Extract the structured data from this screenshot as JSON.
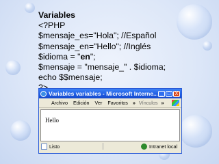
{
  "code": {
    "title": "Variables",
    "lines": [
      "<?PHP",
      "$mensaje_es=\"Hola\"; //Español",
      "$mensaje_en=\"Hello\"; //Inglés",
      "echo $$mensaje;",
      "?>"
    ],
    "line_idioma_prefix": "$idioma = \"",
    "line_idioma_value": "en",
    "line_idioma_suffix": "\";",
    "line_concat": "$mensaje = \"mensaje_\" . $idioma;"
  },
  "browser": {
    "window_title": "Variables variables - Microsoft Interne...",
    "minimize": "_",
    "maximize": "□",
    "close": "X",
    "menu": {
      "archivo": "Archivo",
      "edicion": "Edición",
      "ver": "Ver",
      "favoritos": "Favoritos",
      "chevron": "»",
      "vinculos": "Vínculos",
      "chevron2": "»"
    },
    "content_text": "Hello",
    "status_left": "Listo",
    "status_zone": "Intranet local"
  }
}
